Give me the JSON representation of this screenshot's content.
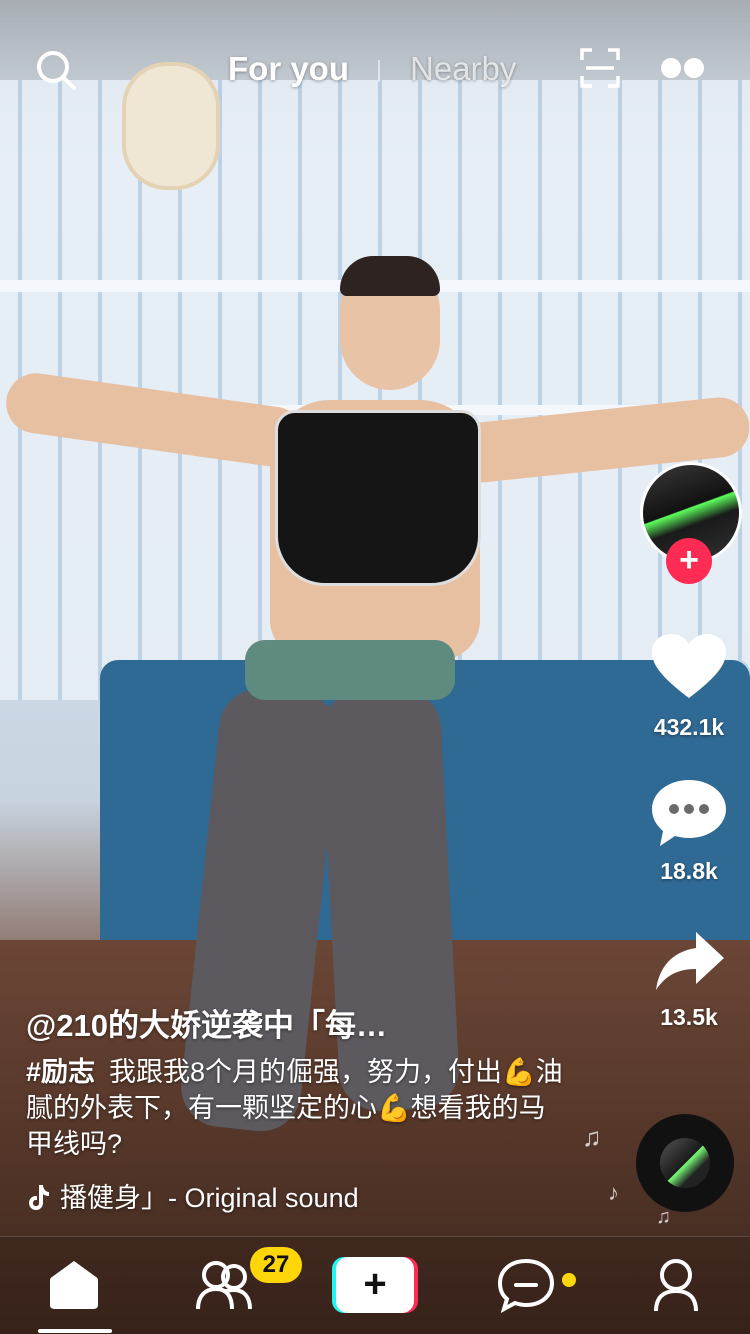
{
  "topbar": {
    "tabs": [
      {
        "label": "For you",
        "active": true
      },
      {
        "label": "Nearby",
        "active": false
      }
    ],
    "icons": [
      "search-icon",
      "scan-icon",
      "live-icon"
    ]
  },
  "rail": {
    "follow_label": "+",
    "likes": "432.1k",
    "comments": "18.8k",
    "shares": "13.5k",
    "icons": [
      "heart-icon",
      "comment-icon",
      "share-icon",
      "music-disc"
    ]
  },
  "post": {
    "username": "@210的大娇逆袭中「每…",
    "hashtag": "#励志",
    "caption": "我跟我8个月的倔强，努力，付出💪油腻的外表下，有一颗坚定的心💪想看我的马甲线吗?",
    "sound": "播健身」- Original sound"
  },
  "bottomnav": {
    "create_label": "+",
    "friends_badge": "27",
    "items": [
      "home-icon",
      "friends-icon",
      "create-button",
      "inbox-icon",
      "profile-icon"
    ]
  },
  "colors": {
    "accent_red": "#fe2c55",
    "accent_cyan": "#25f4ee",
    "badge_yellow": "#ffd60a"
  }
}
